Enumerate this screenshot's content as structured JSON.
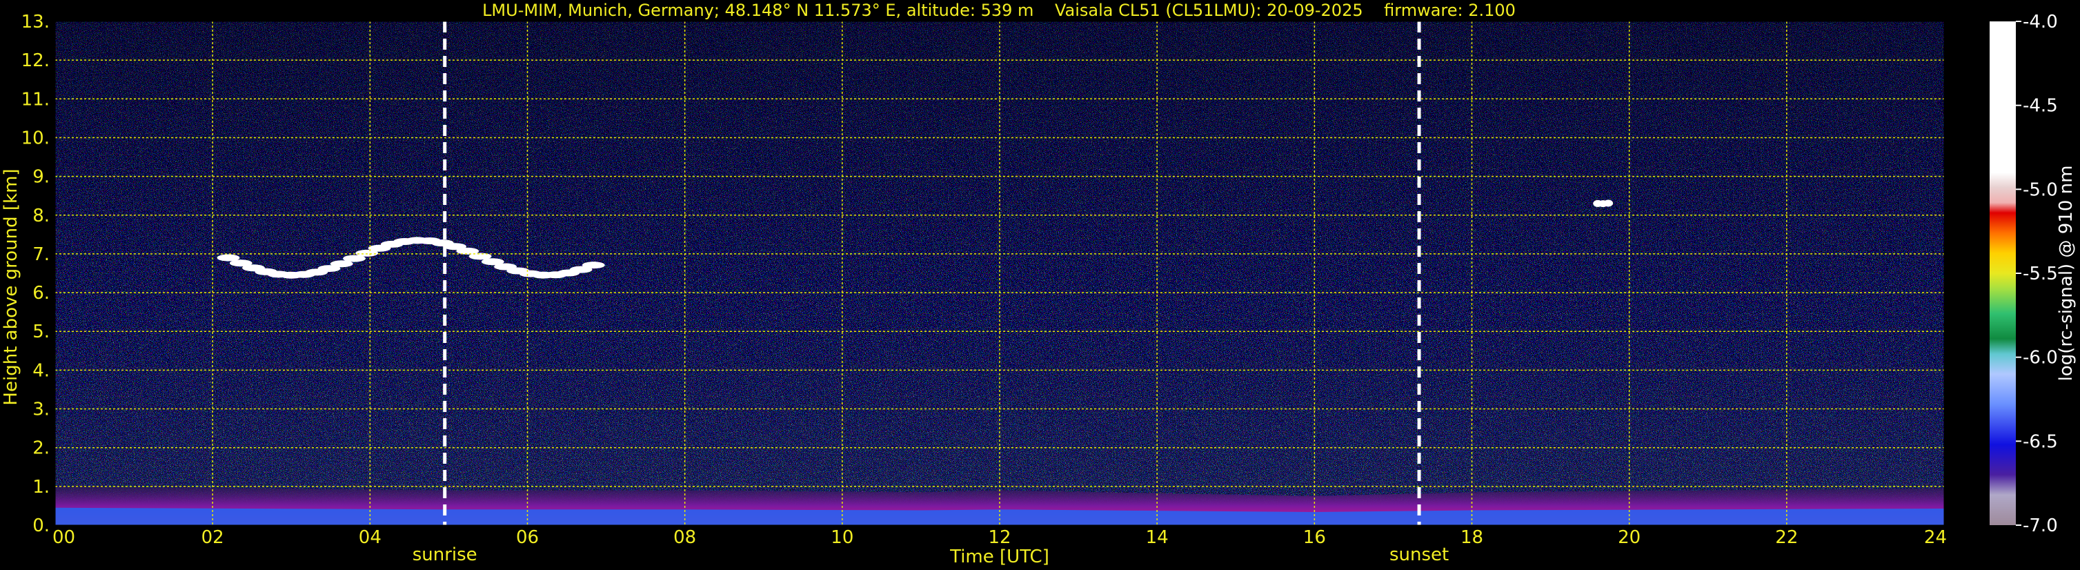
{
  "chart_data": {
    "type": "heatmap",
    "title": "LMU-MIM, Munich, Germany; 48.148° N 11.573° E, altitude: 539 m    Vaisala CL51 (CL51LMU): 20-09-2025    firmware: 2.100",
    "xlabel": "Time [UTC]",
    "ylabel": "Height above ground [km]",
    "xlim": [
      0,
      24
    ],
    "ylim": [
      0,
      13
    ],
    "x_ticks": [
      0,
      2,
      4,
      6,
      8,
      10,
      12,
      14,
      16,
      18,
      20,
      22,
      24
    ],
    "x_tick_labels": [
      "00",
      "02",
      "04",
      "06",
      "08",
      "10",
      "12",
      "14",
      "16",
      "18",
      "20",
      "22",
      "24"
    ],
    "y_ticks": [
      0,
      1,
      2,
      3,
      4,
      5,
      6,
      7,
      8,
      9,
      10,
      11,
      12,
      13
    ],
    "y_tick_labels": [
      "0.",
      "1.",
      "2.",
      "3.",
      "4.",
      "5.",
      "6.",
      "7.",
      "8.",
      "9.",
      "10.",
      "11.",
      "12.",
      "13."
    ],
    "grid": true,
    "grid_color": "#e8e800",
    "text_color": "#f2ee23",
    "annotations": [
      {
        "label": "sunrise",
        "x": 4.95
      },
      {
        "label": "sunset",
        "x": 17.33
      }
    ],
    "colorbar": {
      "label": "log(rc-signal) @ 910 nm",
      "range": [
        -7.0,
        -4.0
      ],
      "ticks": [
        -7.0,
        -6.5,
        -6.0,
        -5.5,
        -5.0,
        -4.5,
        -4.0
      ],
      "tick_labels": [
        "-7.0",
        "-6.5",
        "-6.0",
        "-5.5",
        "-5.0",
        "-4.5",
        "-4.0"
      ],
      "colors": [
        "#9e8a9a",
        "#a592a6",
        "#b0a8c8",
        "#4a1fa0",
        "#1010e0",
        "#3060ff",
        "#6a90ff",
        "#90b0ff",
        "#b0c8ff",
        "#60c8d0",
        "#108a40",
        "#20a050",
        "#30c070",
        "#60d060",
        "#a8e040",
        "#e8e820",
        "#ffd000",
        "#ffa000",
        "#ff7000",
        "#ff3000",
        "#e00000",
        "#f0b0b0",
        "#e8d0d0",
        "#ffffff"
      ]
    },
    "features": {
      "cloud_layers": [
        {
          "time_range": [
            2.2,
            7.0
          ],
          "height_range": [
            6.4,
            7.4
          ]
        },
        {
          "time_range": [
            19.6,
            19.8
          ],
          "height_range": [
            8.2,
            8.4
          ]
        }
      ],
      "boundary_layer_top_km": [
        {
          "time": 0,
          "value": 1.0
        },
        {
          "time": 5,
          "value": 0.9
        },
        {
          "time": 8,
          "value": 0.9
        },
        {
          "time": 11,
          "value": 0.85
        },
        {
          "time": 12,
          "value": 0.9
        },
        {
          "time": 16,
          "value": 0.75
        },
        {
          "time": 18,
          "value": 0.85
        },
        {
          "time": 24,
          "value": 0.95
        }
      ]
    }
  }
}
